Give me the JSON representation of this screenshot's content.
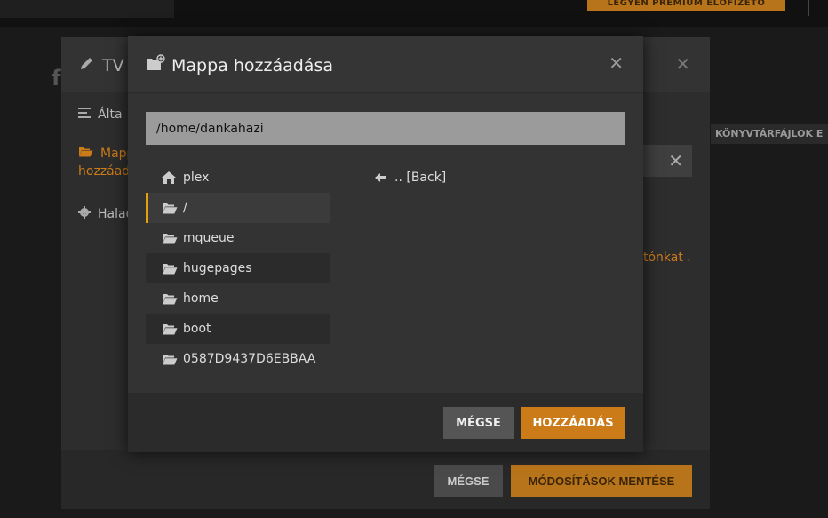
{
  "topbar": {
    "premium_label": "LEGYEN PRÉMIUM ELŐFIZETŐ"
  },
  "background": {
    "logo_letter": "f",
    "library_files_tab": "KÖNYVTÁRFÁJLOK E",
    "edit_dialog": {
      "title": "TV",
      "nav": [
        {
          "label": "Álta"
        },
        {
          "label": "Mapp"
        },
        {
          "label": "hozzáada"
        },
        {
          "label": "Halad"
        }
      ],
      "link_text": "tónkat .",
      "cancel_label": "MÉGSE",
      "save_label": "MÓDOSÍTÁSOK MENTÉSE"
    }
  },
  "modal": {
    "title": "Mappa hozzáadása",
    "path_value": "/home/dankahazi",
    "directories": [
      {
        "label": "plex",
        "icon": "home-icon"
      },
      {
        "label": "/",
        "icon": "folder-open-icon"
      },
      {
        "label": "mqueue",
        "icon": "folder-open-icon"
      },
      {
        "label": "hugepages",
        "icon": "folder-open-icon"
      },
      {
        "label": "home",
        "icon": "folder-open-icon"
      },
      {
        "label": "boot",
        "icon": "folder-open-icon"
      },
      {
        "label": "0587D9437D6EBBAA",
        "icon": "folder-open-icon"
      }
    ],
    "back_entry": ".. [Back]",
    "cancel_label": "MÉGSE",
    "add_label": "HOZZÁADÁS"
  },
  "colors": {
    "accent": "#cc7b19",
    "selection_bar": "#e5a00d"
  }
}
